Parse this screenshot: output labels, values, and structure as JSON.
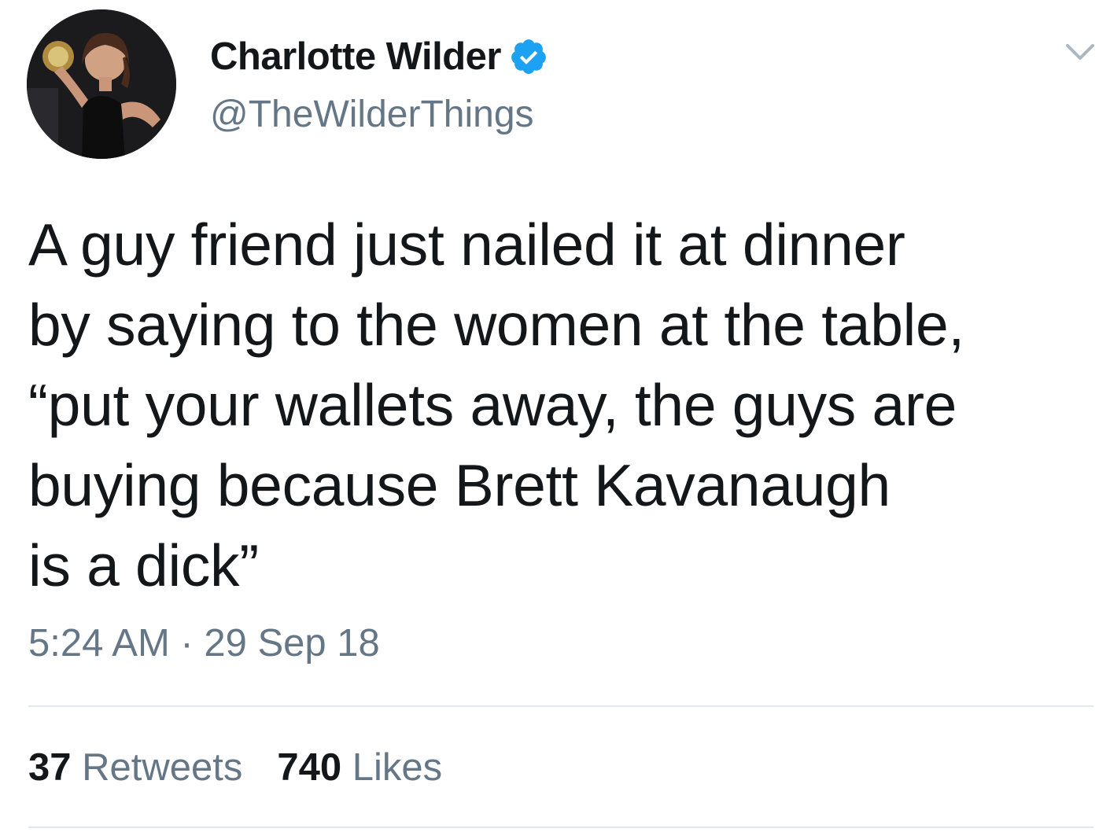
{
  "author": {
    "display_name": "Charlotte Wilder",
    "handle": "@TheWilderThings",
    "verified": true,
    "avatar_icon": "profile-photo"
  },
  "tweet": {
    "text": "A guy friend just nailed it at dinner\nby saying to the women at the table,\n“put your wallets away, the guys are\nbuying because Brett Kavanaugh\nis a dick”",
    "time": "5:24 AM",
    "separator": "·",
    "date": "29 Sep 18"
  },
  "stats": {
    "retweets_count": "37",
    "retweets_label": "Retweets",
    "likes_count": "740",
    "likes_label": "Likes"
  },
  "colors": {
    "text_primary": "#14171a",
    "text_secondary": "#657786",
    "verified_blue": "#1da1f2",
    "divider": "#e1e8ed"
  },
  "icons": {
    "verified": "verified-badge-icon",
    "menu": "chevron-down-icon"
  }
}
